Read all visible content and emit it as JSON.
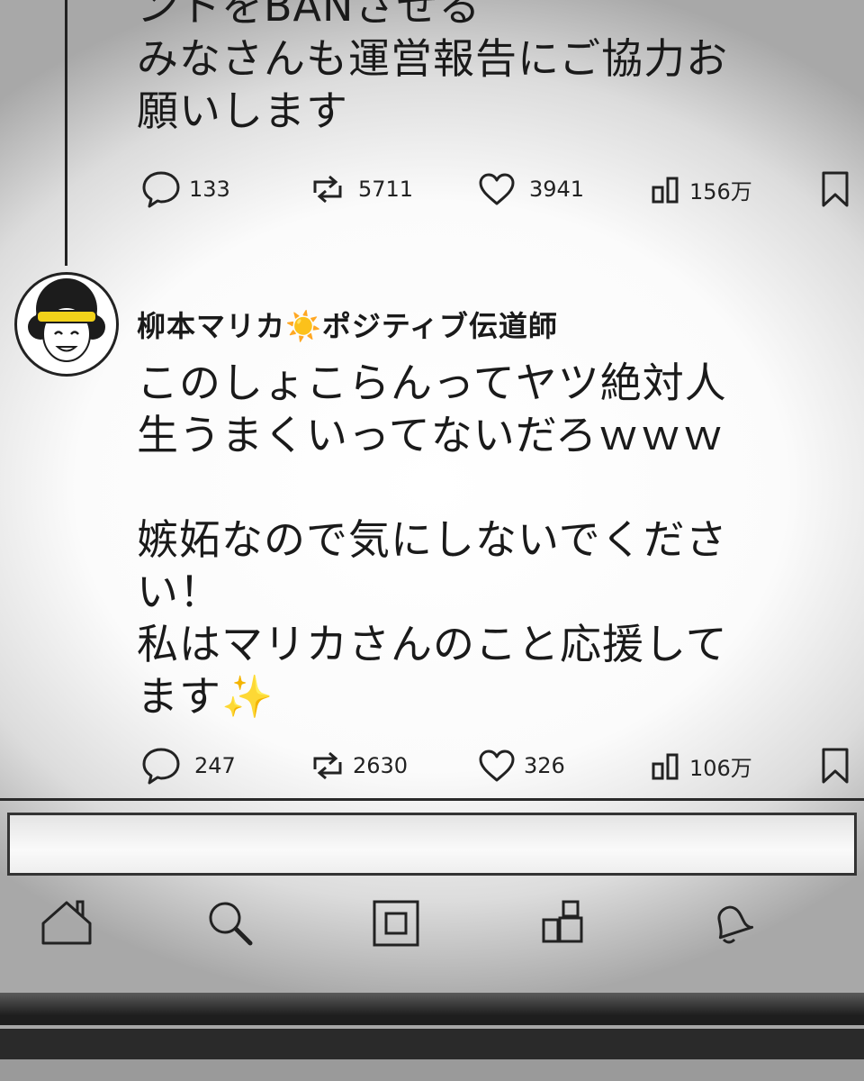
{
  "previous_post": {
    "body": "ントをBANさせる\nみなさんも運営報告にご協力お\n願いします",
    "stats": {
      "replies": "133",
      "reposts": "5711",
      "likes": "3941",
      "views": "156万"
    }
  },
  "post": {
    "author": "柳本マリカ☀️ポジティブ伝道師",
    "body": "このしょこらんってヤツ絶対人\n生うまくいってないだろｗｗｗ\n\n嫉妬なので気にしないでくださ\nい！\n私はマリカさんのこと応援して\nます✨",
    "stats": {
      "replies": "247",
      "reposts": "2630",
      "likes": "326",
      "views": "106万"
    }
  },
  "icons": {
    "reply": "speech-bubble-icon",
    "repost": "repost-arrows-icon",
    "like": "heart-icon",
    "views": "bar-chart-icon",
    "bookmark": "bookmark-icon",
    "nav": [
      "home-icon",
      "search-icon",
      "square-icon",
      "community-icon",
      "bell-icon"
    ]
  },
  "colors": {
    "ink": "#1a1a1a",
    "avatar_headband": "#f2d21a",
    "avatar_hair": "#1c1c1c"
  }
}
